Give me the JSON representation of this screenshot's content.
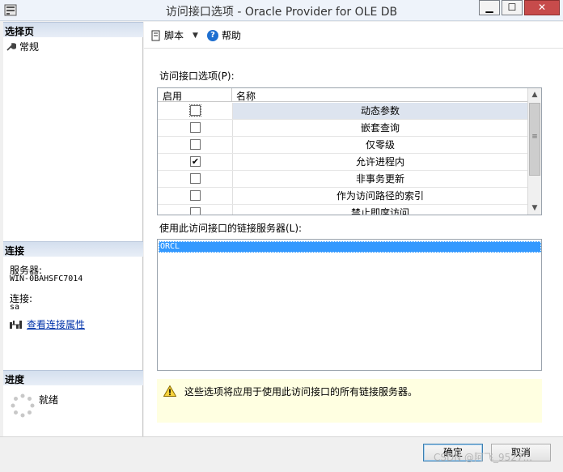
{
  "window": {
    "title": "访问接口选项 - Oracle Provider for OLE DB",
    "minimize_glyph": "▁",
    "maximize_glyph": "☐",
    "close_glyph": "✕"
  },
  "left_panel": {
    "select_page_header": "选择页",
    "pages": [
      {
        "label": "常规",
        "icon": "wrench-icon"
      }
    ],
    "connection_header": "连接",
    "server_label": "服务器:",
    "server_value": "WIN-0BAHSFC7014",
    "connection_label": "连接:",
    "connection_value": "sa",
    "view_connection_properties": "查看连接属性",
    "progress_header": "进度",
    "progress_status": "就绪"
  },
  "toolbar": {
    "script_label": "脚本",
    "help_label": "帮助"
  },
  "provider_options": {
    "label": "访问接口选项(P):",
    "columns": [
      "启用",
      "名称"
    ],
    "rows": [
      {
        "name": "动态参数",
        "checked": false,
        "selected": true
      },
      {
        "name": "嵌套查询",
        "checked": false
      },
      {
        "name": "仅零级",
        "checked": false
      },
      {
        "name": "允许进程内",
        "checked": true
      },
      {
        "name": "非事务更新",
        "checked": false
      },
      {
        "name": "作为访问路径的索引",
        "checked": false
      },
      {
        "name": "禁止即席访问",
        "checked": false
      }
    ]
  },
  "linked_servers": {
    "label": "使用此访问接口的链接服务器(L):",
    "items": [
      "ORCL"
    ]
  },
  "warning": {
    "text": "这些选项将应用于使用此访问接口的所有链接服务器。",
    "icon": "warning-icon",
    "color": "#ffffe1"
  },
  "buttons": {
    "ok": "确定",
    "cancel": "取消"
  },
  "watermark": "CSDN @阿飞_9527..."
}
